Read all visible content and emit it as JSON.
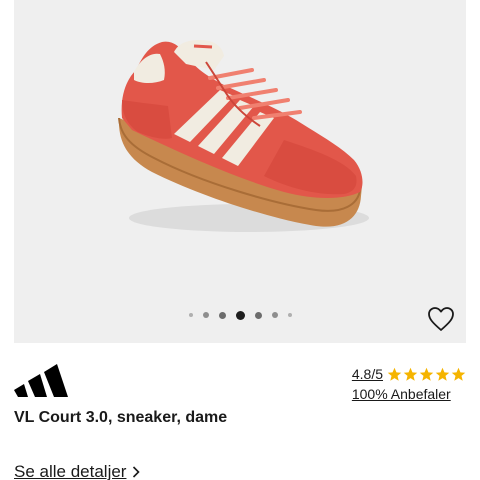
{
  "gallery": {
    "image_icon": "sneaker-photo",
    "slide_count": 7,
    "active_slide": 4,
    "favorite_icon": "heart-outline-icon"
  },
  "product": {
    "brand_logo": "adidas-logo",
    "name": "VL Court 3.0, sneaker, dame",
    "rating_text": "4.8/5",
    "rating_stars": 5,
    "star_color": "#f5b400",
    "recommend_text": "100% Anbefaler",
    "details_link": "Se alle detaljer",
    "details_icon": "chevron-right-icon"
  }
}
